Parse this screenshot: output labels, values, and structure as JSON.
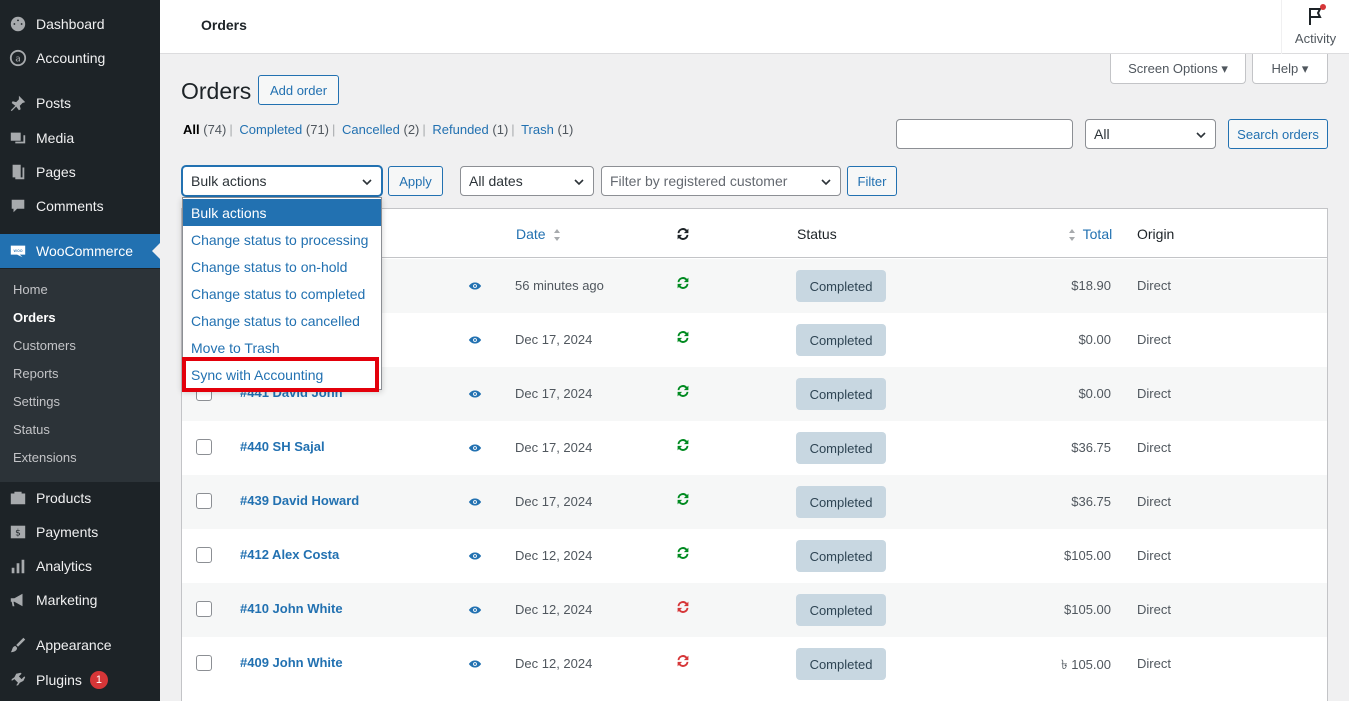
{
  "sidebar": {
    "items": [
      {
        "label": "Dashboard",
        "icon": "dashboard-icon"
      },
      {
        "label": "Accounting",
        "icon": "accounting-icon"
      },
      {
        "label": "Posts",
        "icon": "pin-icon"
      },
      {
        "label": "Media",
        "icon": "media-icon"
      },
      {
        "label": "Pages",
        "icon": "pages-icon"
      },
      {
        "label": "Comments",
        "icon": "comment-icon"
      },
      {
        "label": "WooCommerce",
        "icon": "woo-icon"
      },
      {
        "label": "Products",
        "icon": "products-icon"
      },
      {
        "label": "Payments",
        "icon": "payments-icon"
      },
      {
        "label": "Analytics",
        "icon": "analytics-icon"
      },
      {
        "label": "Marketing",
        "icon": "megaphone-icon"
      },
      {
        "label": "Appearance",
        "icon": "brush-icon"
      },
      {
        "label": "Plugins",
        "icon": "plugin-icon",
        "badge": "1"
      }
    ],
    "woo_submenu": [
      "Home",
      "Orders",
      "Customers",
      "Reports",
      "Settings",
      "Status",
      "Extensions"
    ]
  },
  "header": {
    "title": "Orders",
    "activity_label": "Activity"
  },
  "screen_options_label": "Screen Options",
  "help_label": "Help",
  "page": {
    "title": "Orders",
    "add_order_label": "Add order"
  },
  "filters": {
    "all": {
      "label": "All",
      "count": "(74)"
    },
    "completed": {
      "label": "Completed",
      "count": "(71)"
    },
    "cancelled": {
      "label": "Cancelled",
      "count": "(2)"
    },
    "refunded": {
      "label": "Refunded",
      "count": "(1)"
    },
    "trash": {
      "label": "Trash",
      "count": "(1)"
    }
  },
  "search": {
    "status_value": "All",
    "button_label": "Search orders"
  },
  "toolbar": {
    "bulk_actions_value": "Bulk actions",
    "apply_label": "Apply",
    "dates_value": "All dates",
    "customer_placeholder": "Filter by registered customer",
    "filter_label": "Filter"
  },
  "bulk_dropdown": {
    "options": [
      "Bulk actions",
      "Change status to processing",
      "Change status to on-hold",
      "Change status to completed",
      "Change status to cancelled",
      "Move to Trash",
      "Sync with Accounting"
    ],
    "selected": "Bulk actions"
  },
  "table": {
    "columns": {
      "date": "Date",
      "status": "Status",
      "total": "Total",
      "origin": "Origin"
    },
    "rows": [
      {
        "order": "",
        "date": "56 minutes ago",
        "sync": "synced",
        "status": "Completed",
        "total": "$18.90",
        "origin": "Direct"
      },
      {
        "order": "",
        "date": "Dec 17, 2024",
        "sync": "synced",
        "status": "Completed",
        "total": "$0.00",
        "origin": "Direct"
      },
      {
        "order": "#441 David John",
        "date": "Dec 17, 2024",
        "sync": "synced",
        "status": "Completed",
        "total": "$0.00",
        "origin": "Direct"
      },
      {
        "order": "#440 SH Sajal",
        "date": "Dec 17, 2024",
        "sync": "synced",
        "status": "Completed",
        "total": "$36.75",
        "origin": "Direct"
      },
      {
        "order": "#439 David Howard",
        "date": "Dec 17, 2024",
        "sync": "synced",
        "status": "Completed",
        "total": "$36.75",
        "origin": "Direct"
      },
      {
        "order": "#412 Alex Costa",
        "date": "Dec 12, 2024",
        "sync": "synced",
        "status": "Completed",
        "total": "$105.00",
        "origin": "Direct"
      },
      {
        "order": "#410 John White",
        "date": "Dec 12, 2024",
        "sync": "not-synced",
        "status": "Completed",
        "total": "$105.00",
        "origin": "Direct"
      },
      {
        "order": "#409 John White",
        "date": "Dec 12, 2024",
        "sync": "not-synced",
        "status": "Completed",
        "total": "৳ 105.00",
        "origin": "Direct"
      }
    ]
  },
  "colors": {
    "accent": "#2271b1",
    "sidebar": "#1d2327",
    "synced": "#008a20",
    "not_synced": "#d63638",
    "highlight": "#e3000b"
  }
}
